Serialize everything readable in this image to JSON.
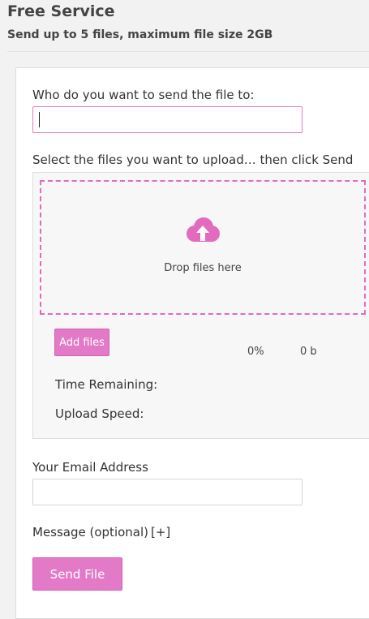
{
  "header": {
    "title": "Free Service",
    "subtitle": "Send up to 5 files, maximum file size 2GB"
  },
  "form": {
    "recipient_label": "Who do you want to send the file to:",
    "recipient_value": "",
    "upload_label": "Select the files you want to upload… then click Send",
    "dropzone": {
      "icon": "cloud-upload-icon",
      "text": "Drop files here"
    },
    "add_files_label": "Add files",
    "progress_percent": "0%",
    "bytes_uploaded": "0 b",
    "time_remaining_label": "Time Remaining:",
    "upload_speed_label": "Upload Speed:",
    "email_label": "Your Email Address",
    "email_value": "",
    "message_label": "Message (optional)",
    "message_toggle": "[+]",
    "send_label": "Send File"
  },
  "colors": {
    "accent": "#e37ac8",
    "dashed_border": "#e26bbd",
    "background": "#f2f2f2"
  }
}
